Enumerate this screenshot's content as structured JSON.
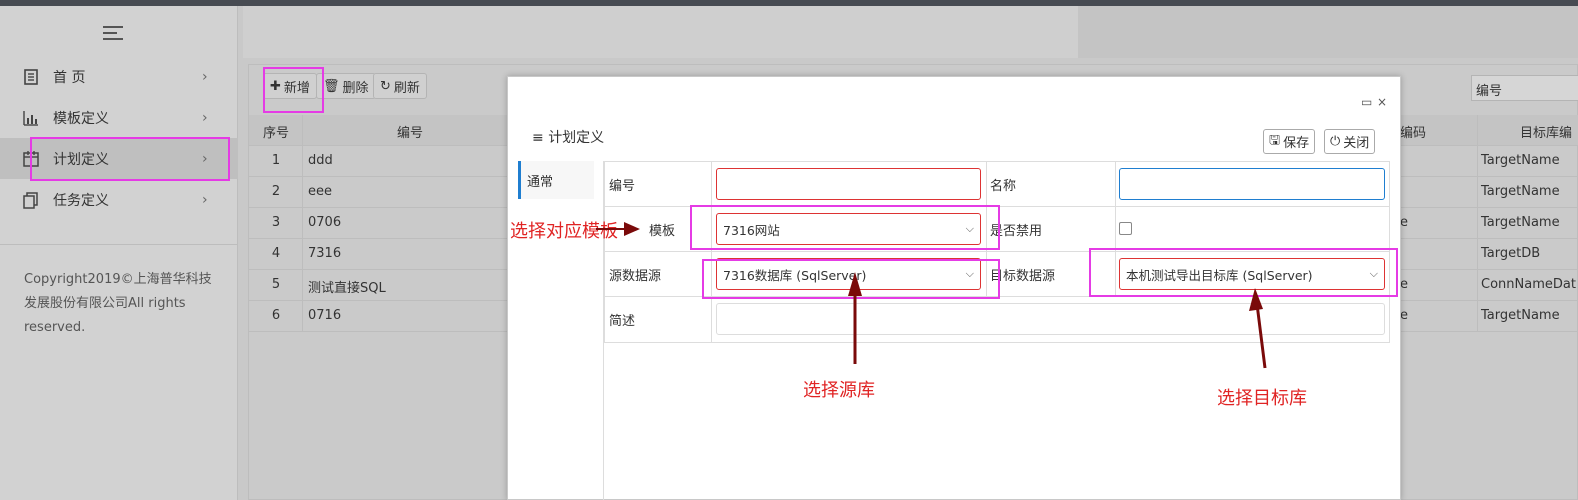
{
  "sidebar": {
    "items": [
      {
        "label": "首 页",
        "icon": "book-icon"
      },
      {
        "label": "模板定义",
        "icon": "bar-chart-icon"
      },
      {
        "label": "计划定义",
        "icon": "calendar-icon"
      },
      {
        "label": "任务定义",
        "icon": "copy-icon"
      }
    ],
    "copyright": "Copyright2019©上海普华科技发展股份有限公司All rights reserved."
  },
  "toolbar": {
    "add": "新增",
    "delete": "删除",
    "refresh": "刷新"
  },
  "search": {
    "field": "编号"
  },
  "grid": {
    "headers": [
      "序号",
      "编号"
    ],
    "rows": [
      {
        "index": "1",
        "code": "ddd"
      },
      {
        "index": "2",
        "code": "eee"
      },
      {
        "index": "3",
        "code": "0706"
      },
      {
        "index": "4",
        "code": "7316"
      },
      {
        "index": "5",
        "code": "测试直接SQL"
      },
      {
        "index": "6",
        "code": "0716"
      }
    ],
    "right_headers": [
      "编码",
      "目标库编"
    ],
    "right_rows": [
      {
        "a": "",
        "b": "TargetName"
      },
      {
        "a": "",
        "b": "TargetName"
      },
      {
        "a": "e",
        "b": "TargetName"
      },
      {
        "a": "",
        "b": "TargetDB"
      },
      {
        "a": "e",
        "b": "ConnNameDat"
      },
      {
        "a": "e",
        "b": "TargetName"
      }
    ]
  },
  "modal": {
    "title": "计划定义",
    "save": "保存",
    "close": "关闭",
    "tab": "通常",
    "fields": {
      "code_label": "编号",
      "code_value": "",
      "name_label": "名称",
      "name_value": "",
      "template_label": "模板",
      "template_value": "7316网站",
      "disabled_label": "是否禁用",
      "source_label": "源数据源",
      "source_value": "7316数据库 (SqlServer)",
      "target_label": "目标数据源",
      "target_value": "本机测试导出目标库 (SqlServer)",
      "desc_label": "简述",
      "desc_value": ""
    }
  },
  "annotations": {
    "template": "选择对应模板",
    "source": "选择源库",
    "target": "选择目标库"
  },
  "colors": {
    "highlight": "#e53be5",
    "annotation_text": "#e02424",
    "arrow": "#7a0a0a",
    "accent": "#1f7ed0"
  }
}
